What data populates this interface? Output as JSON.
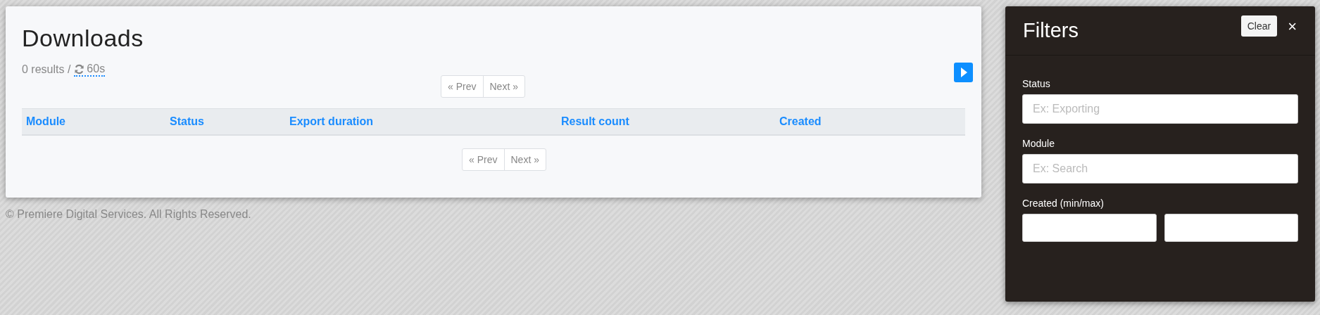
{
  "downloads": {
    "title": "Downloads",
    "summary": "0 results /",
    "refresh": "60s",
    "pager_top": {
      "prev": "« Prev",
      "next": "Next »"
    },
    "table": {
      "columns": [
        "Module",
        "Status",
        "Export duration",
        "Result count",
        "Created"
      ]
    },
    "pager_bottom": {
      "prev": "« Prev",
      "next": "Next »"
    }
  },
  "footer": "© Premiere Digital Services. All Rights Reserved.",
  "filters": {
    "title": "Filters",
    "clear": "Clear",
    "close": "×",
    "fields": [
      {
        "kind": "text",
        "label": "Status",
        "placeholder": "Ex: Exporting"
      },
      {
        "kind": "text",
        "label": "Module",
        "placeholder": "Ex: Search"
      },
      {
        "kind": "range",
        "label": "Created (min/max)"
      }
    ]
  }
}
